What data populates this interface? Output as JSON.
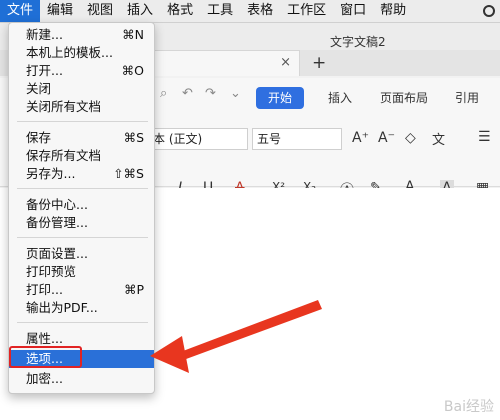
{
  "menubar": {
    "items": [
      "文件",
      "编辑",
      "视图",
      "插入",
      "格式",
      "工具",
      "表格",
      "工作区",
      "窗口",
      "帮助"
    ],
    "active_index": 0,
    "right_icon": "siri-icon"
  },
  "app": {
    "doc_title": "文字文稿2",
    "tab_close": "×",
    "new_tab": "+",
    "ribbon_tabs": [
      "开始",
      "插入",
      "页面布局",
      "引用"
    ],
    "font_name": "本 (正文)",
    "font_size": "五号",
    "quick_icons": [
      "undo-icon",
      "redo-icon",
      "customize-icon"
    ],
    "toolbar_text": {
      "grow": "A⁺",
      "shrink": "A⁻",
      "italic": "I",
      "underline": "U",
      "strike": "A",
      "superscript": "X²",
      "subscript": "X₂",
      "font_color": "A",
      "shading": "A"
    }
  },
  "file_menu": {
    "items": [
      {
        "label": "新建...",
        "shortcut": "⌘N"
      },
      {
        "label": "本机上的模板...",
        "shortcut": ""
      },
      {
        "label": "打开...",
        "shortcut": "⌘O"
      },
      {
        "label": "关闭",
        "shortcut": ""
      },
      {
        "label": "关闭所有文档",
        "shortcut": ""
      },
      {
        "label": "保存",
        "shortcut": "⌘S"
      },
      {
        "label": "保存所有文档",
        "shortcut": ""
      },
      {
        "label": "另存为...",
        "shortcut": "⇧⌘S"
      },
      {
        "label": "备份中心...",
        "shortcut": ""
      },
      {
        "label": "备份管理...",
        "shortcut": ""
      },
      {
        "label": "页面设置...",
        "shortcut": ""
      },
      {
        "label": "打印预览",
        "shortcut": ""
      },
      {
        "label": "打印...",
        "shortcut": "⌘P"
      },
      {
        "label": "输出为PDF...",
        "shortcut": ""
      },
      {
        "label": "属性...",
        "shortcut": ""
      },
      {
        "label": "选项...",
        "shortcut": ""
      },
      {
        "label": "加密...",
        "shortcut": ""
      }
    ],
    "selected_index": 15,
    "highlight_color": "#e12323",
    "selection_color": "#2a70d8"
  },
  "annotation": {
    "arrow_color": "#e8361f"
  },
  "watermark": "Bai经验"
}
